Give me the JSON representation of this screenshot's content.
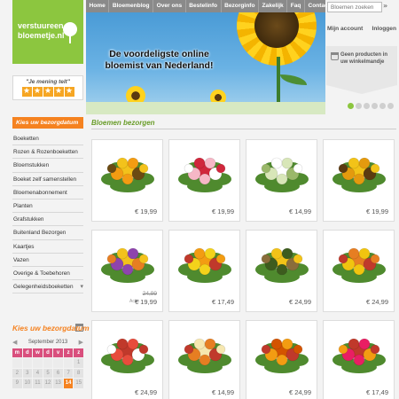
{
  "logo": {
    "text": "verstuureen bloemetje.nl"
  },
  "rating": {
    "label": "\"Je mening telt\"",
    "stars": 5
  },
  "nav": {
    "items": [
      "Home",
      "Bloemenblog",
      "Over ons",
      "Bestelinfo",
      "Bezorginfo",
      "Zakelijk",
      "Faq",
      "Contact"
    ]
  },
  "hero": {
    "headline": "De voordeligste online bloemist van Nederland!"
  },
  "search": {
    "placeholder": "Bloemen zoeken"
  },
  "account": {
    "my_account": "Mijn account",
    "login": "Inloggen"
  },
  "cart": {
    "text": "Geen producten in uw winkelmandje"
  },
  "slider": {
    "count": 6,
    "active": 0
  },
  "sidebar": {
    "heading": "Kies uw bezorgdatum",
    "items": [
      "Boeketten",
      "Rozen & Rozenboeketten",
      "Bloemstukken",
      "Boeket zelf samenstellen",
      "Bloemenabonnement",
      "Planten",
      "Grafstukken",
      "Buitenland Bezorgen",
      "Kaartjes",
      "Vazen",
      "Overige & Toebehoren",
      "Gelegenheidsboeketten"
    ]
  },
  "date_picker": {
    "title": "Kies uw bezorgdatum",
    "month": "September 2013",
    "prev": "◀",
    "next": "▶",
    "weekdays": [
      "m",
      "d",
      "w",
      "d",
      "v",
      "z",
      "z"
    ],
    "days": [
      [
        "",
        "",
        "",
        "",
        "",
        "",
        "1"
      ],
      [
        "2",
        "3",
        "4",
        "5",
        "6",
        "7",
        "8"
      ],
      [
        "9",
        "10",
        "11",
        "12",
        "13",
        "14",
        "15"
      ]
    ],
    "selected": "14"
  },
  "main": {
    "title": "Bloemen bezorgen",
    "products": [
      {
        "price": "€ 19,99",
        "colors": [
          "#f3c21b",
          "#f39c12",
          "#6b4a12"
        ]
      },
      {
        "price": "€ 19,99",
        "colors": [
          "#d0273c",
          "#f6b7c6",
          "#ffffff"
        ]
      },
      {
        "price": "€ 14,99",
        "colors": [
          "#ffffff",
          "#d8e6b8",
          "#9ab86a"
        ]
      },
      {
        "price": "€ 19,99",
        "colors": [
          "#f2c318",
          "#e49a0e",
          "#5b3a10"
        ]
      },
      {
        "price": "€ 19,99",
        "old_price": "24,99",
        "tag": "Actie",
        "colors": [
          "#f3c21b",
          "#8e44ad",
          "#e67e22"
        ]
      },
      {
        "price": "€ 17,49",
        "colors": [
          "#f39c12",
          "#f3d21b",
          "#c0392b"
        ]
      },
      {
        "price": "€ 24,99",
        "colors": [
          "#f2c318",
          "#3d5c1e",
          "#8a6d3b"
        ]
      },
      {
        "price": "€ 24,99",
        "colors": [
          "#e67e22",
          "#f1c40f",
          "#c0392b"
        ]
      },
      {
        "price": "€ 24,99",
        "colors": [
          "#c0392b",
          "#e74c3c",
          "#ffffff"
        ]
      },
      {
        "price": "€ 14,99",
        "colors": [
          "#f6e7b0",
          "#e67e22",
          "#c0392b"
        ]
      },
      {
        "price": "€ 24,99",
        "colors": [
          "#d35400",
          "#f39c12",
          "#c0392b"
        ]
      },
      {
        "price": "€ 17,49",
        "colors": [
          "#c0392b",
          "#e91e63",
          "#f39c12"
        ]
      }
    ]
  },
  "colors": {
    "brand_green": "#8cc63f",
    "accent_orange": "#f58220",
    "nav_gray": "#8a8a8a",
    "calendar_pink": "#d94f7d"
  }
}
